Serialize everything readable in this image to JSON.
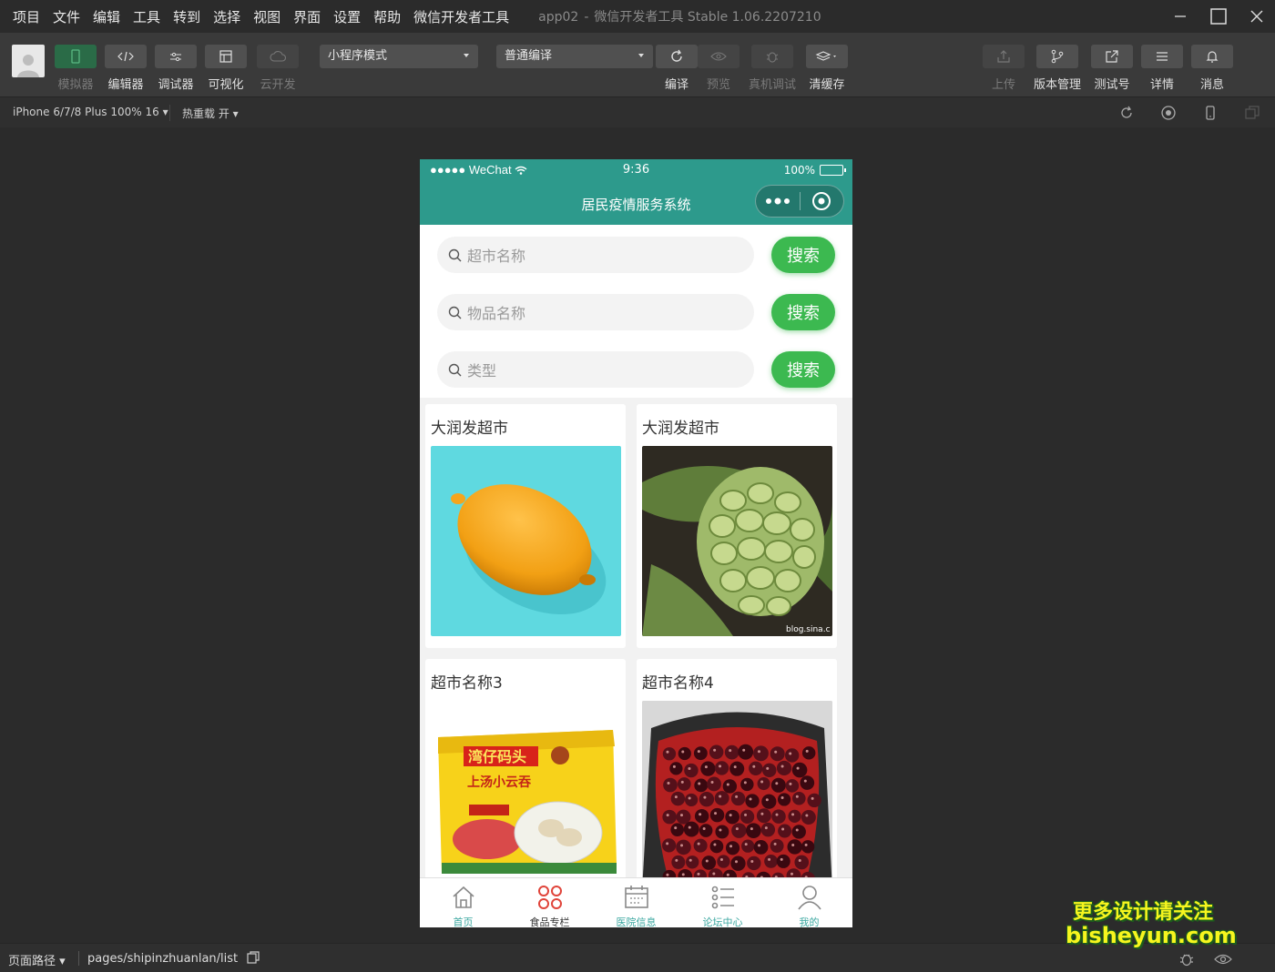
{
  "menu": [
    "项目",
    "文件",
    "编辑",
    "工具",
    "转到",
    "选择",
    "视图",
    "界面",
    "设置",
    "帮助",
    "微信开发者工具"
  ],
  "window": {
    "project": "app02",
    "separator": "-",
    "product": "微信开发者工具 Stable 1.06.2207210"
  },
  "toolbar": {
    "simulator": "模拟器",
    "editor": "编辑器",
    "debugger": "调试器",
    "visual": "可视化",
    "cloud": "云开发",
    "mode_select": "小程序模式",
    "compile_select": "普通编译",
    "compile": "编译",
    "preview": "预览",
    "real_debug": "真机调试",
    "clear_cache": "清缓存",
    "upload": "上传",
    "version": "版本管理",
    "test_account": "测试号",
    "details": "详情",
    "messages": "消息"
  },
  "subbar": {
    "device": "iPhone 6/7/8 Plus 100% 16 ▾",
    "hot_reload": "热重载 开 ▾"
  },
  "phone": {
    "status": {
      "carrier": "●●●●● WeChat",
      "time": "9:36",
      "battery": "100%",
      "battery_level": 100
    },
    "nav_title": "居民疫情服务系统",
    "search_rows": [
      {
        "placeholder": "超市名称",
        "button": "搜索"
      },
      {
        "placeholder": "物品名称",
        "button": "搜索"
      },
      {
        "placeholder": "类型",
        "button": "搜索"
      }
    ],
    "cards": [
      {
        "title": "大润发超市",
        "image": "lemon-image"
      },
      {
        "title": "大润发超市",
        "image": "custard-apple-image",
        "image_text": "blog.sina.c"
      },
      {
        "title": "超市名称3",
        "image": "dumpling-package-image",
        "brand_text": "湾仔码头",
        "product_text": "上汤小云吞"
      },
      {
        "title": "超市名称4",
        "image": "cherries-image"
      }
    ],
    "tabs": [
      {
        "label": "首页",
        "icon": "home-icon",
        "active": false
      },
      {
        "label": "食品专栏",
        "icon": "grid-icon",
        "active": true
      },
      {
        "label": "医院信息",
        "icon": "calendar-icon",
        "active": false
      },
      {
        "label": "论坛中心",
        "icon": "list-icon",
        "active": false
      },
      {
        "label": "我的",
        "icon": "user-icon",
        "active": false
      }
    ]
  },
  "bottom": {
    "path_label": "页面路径 ▾",
    "path": "pages/shipinzhuanlan/list"
  },
  "watermark": {
    "line1": "更多设计请关注",
    "line2": "bisheyun.com"
  },
  "colors": {
    "accent": "#2d9a8c",
    "button": "#3cb950",
    "tab_active_icon": "#e0443a"
  }
}
